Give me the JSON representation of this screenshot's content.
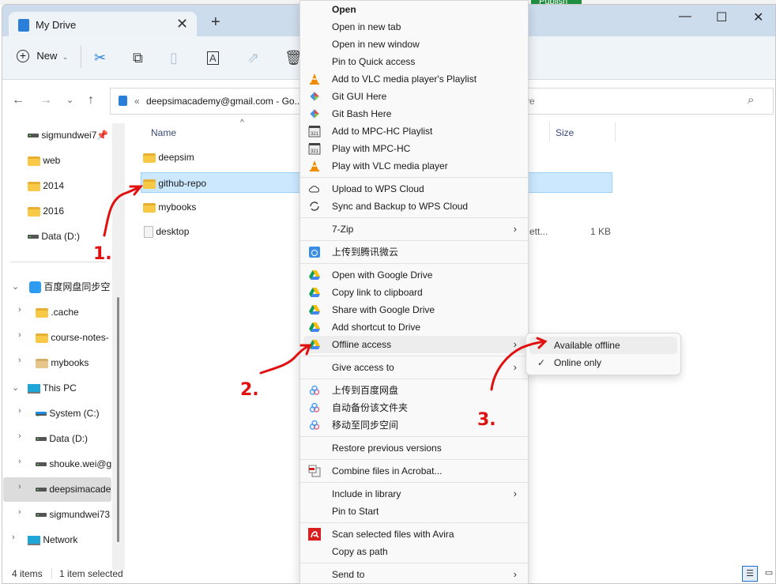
{
  "background_app": {
    "publish_label": "Publish"
  },
  "window": {
    "tab_title": "My Drive",
    "new_tab": "+",
    "close_tab": "✕",
    "minimize": "—",
    "maximize": "☐",
    "close": "✕"
  },
  "toolbar": {
    "new_label": "New"
  },
  "address": {
    "path": "deepsimacademy@gmail.com - Go...",
    "search_placeholder": "ve"
  },
  "sidebar": {
    "items": [
      {
        "label": "sigmundwei7"
      },
      {
        "label": "web"
      },
      {
        "label": "2014"
      },
      {
        "label": "2016"
      },
      {
        "label": "Data (D:)"
      },
      {
        "label": "百度网盘同步空"
      },
      {
        "label": ".cache"
      },
      {
        "label": "course-notes-"
      },
      {
        "label": "mybooks"
      },
      {
        "label": "This PC"
      },
      {
        "label": "System (C:)"
      },
      {
        "label": "Data (D:)"
      },
      {
        "label": "shouke.wei@g"
      },
      {
        "label": "deepsimacade"
      },
      {
        "label": "sigmundwei73"
      },
      {
        "label": "Network"
      }
    ]
  },
  "files": {
    "headers": {
      "name": "Name",
      "size": "Size"
    },
    "rows": [
      {
        "name": "deepsim"
      },
      {
        "name": "github-repo",
        "selected": true
      },
      {
        "name": "mybooks"
      },
      {
        "name": "desktop",
        "type": "ett...",
        "size": "1 KB"
      }
    ]
  },
  "context_menu": {
    "groups": [
      [
        {
          "label": "Open",
          "bold": true
        },
        {
          "label": "Open in new tab"
        },
        {
          "label": "Open in new window"
        },
        {
          "label": "Pin to Quick access"
        },
        {
          "label": "Add to VLC media player's Playlist",
          "icon": "vlc-icon"
        },
        {
          "label": "Git GUI Here",
          "icon": "git-icon"
        },
        {
          "label": "Git Bash Here",
          "icon": "git-icon"
        },
        {
          "label": "Add to MPC-HC Playlist",
          "icon": "mpc-hc-icon"
        },
        {
          "label": "Play with MPC-HC",
          "icon": "mpc-hc-icon"
        },
        {
          "label": "Play with VLC media player",
          "icon": "vlc-icon"
        }
      ],
      [
        {
          "label": "Upload to WPS Cloud",
          "icon": "cloud-icon"
        },
        {
          "label": "Sync and Backup to WPS Cloud",
          "icon": "sync-icon"
        }
      ],
      [
        {
          "label": "7-Zip",
          "submenu": true
        }
      ],
      [
        {
          "label": "上传到腾讯微云",
          "icon": "weiyun-icon"
        }
      ],
      [
        {
          "label": "Open with Google Drive",
          "icon": "google-drive-icon"
        },
        {
          "label": "Copy link to clipboard",
          "icon": "google-drive-icon"
        },
        {
          "label": "Share with Google Drive",
          "icon": "google-drive-icon"
        },
        {
          "label": "Add shortcut to Drive",
          "icon": "google-drive-icon"
        },
        {
          "label": "Offline access",
          "icon": "google-drive-icon",
          "submenu": true,
          "highlighted": true
        }
      ],
      [
        {
          "label": "Give access to",
          "submenu": true
        }
      ],
      [
        {
          "label": "上传到百度网盘",
          "icon": "baidu-icon"
        },
        {
          "label": "自动备份该文件夹",
          "icon": "baidu-icon"
        },
        {
          "label": "移动至同步空间",
          "icon": "baidu-icon"
        }
      ],
      [
        {
          "label": "Restore previous versions"
        }
      ],
      [
        {
          "label": "Combine files in Acrobat...",
          "icon": "acrobat-icon"
        }
      ],
      [
        {
          "label": "Include in library",
          "submenu": true
        },
        {
          "label": "Pin to Start"
        }
      ],
      [
        {
          "label": "Scan selected files with Avira",
          "icon": "avira-icon"
        },
        {
          "label": "Copy as path"
        }
      ],
      [
        {
          "label": "Send to",
          "submenu": true
        }
      ]
    ]
  },
  "submenu": {
    "items": [
      {
        "label": "Available offline",
        "highlighted": true
      },
      {
        "label": "Online only",
        "checked": true
      }
    ]
  },
  "annotations": {
    "step1": "1.",
    "step2": "2.",
    "step3": "3."
  },
  "status": {
    "count": "4 items",
    "selected": "1 item selected"
  },
  "colors": {
    "accent": "#0067c0",
    "selection": "#cce8ff",
    "annotation": "#e01010"
  }
}
